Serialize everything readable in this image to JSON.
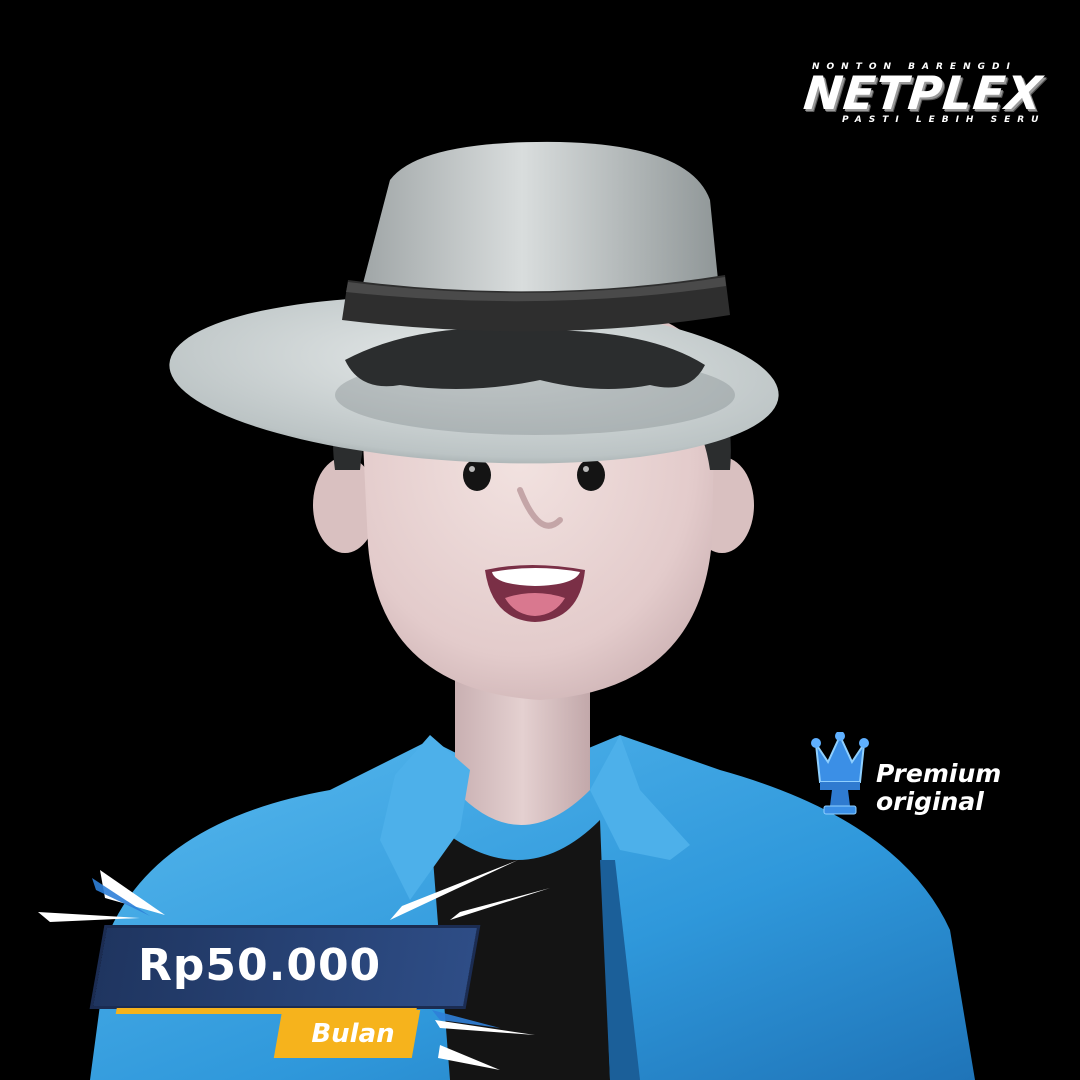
{
  "brand": {
    "tagline_top": "NONTON BARENGDI",
    "name": "NETPLEX",
    "tagline_bottom": "PASTI LEBIH SERU"
  },
  "badge": {
    "line1": "Premium",
    "line2": "original",
    "icon": "crown-icon"
  },
  "price": {
    "amount": "Rp50.000",
    "period": "Bulan"
  },
  "colors": {
    "background": "#000000",
    "jacket": "#3aa3e0",
    "hat": "#c9cfcf",
    "price_panel": "#2a4478",
    "accent_yellow": "#f6b31c",
    "crown_blue": "#3b8fe6"
  }
}
